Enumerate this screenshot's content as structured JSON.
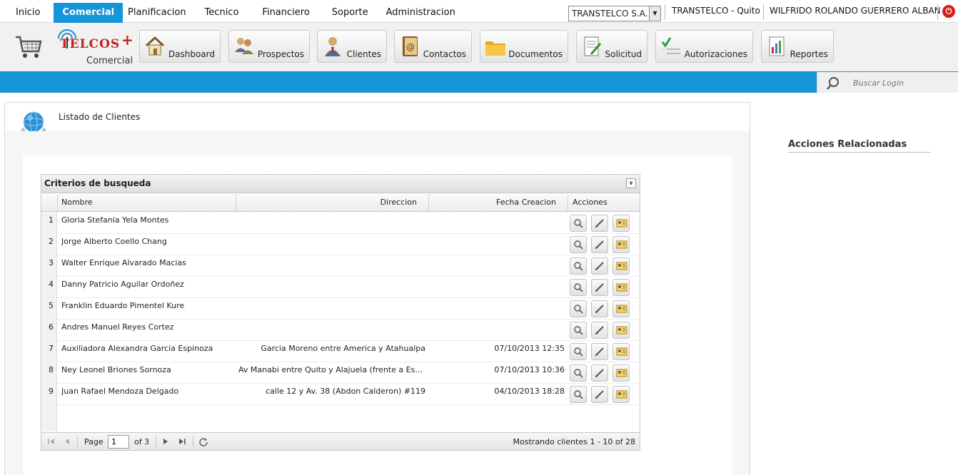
{
  "menu": {
    "items": [
      "Inicio",
      "Comercial",
      "Planificacion",
      "Tecnico",
      "Financiero",
      "Soporte",
      "Administracion"
    ],
    "active": "Comercial"
  },
  "top_right": {
    "company": "TRANSTELCO S.A.",
    "office": "TRANSTELCO - Quito",
    "user": "WILFRIDO ROLANDO GUERRERO ALBAN"
  },
  "logo": {
    "brand": "TELCOS",
    "plus": "+",
    "module": "Comercial"
  },
  "toolbar": {
    "buttons": [
      {
        "label": "Dashboard",
        "icon": "house-icon"
      },
      {
        "label": "Prospectos",
        "icon": "prospects-icon"
      },
      {
        "label": "Clientes",
        "icon": "client-person-icon"
      },
      {
        "label": "Contactos",
        "icon": "address-book-icon"
      },
      {
        "label": "Documentos",
        "icon": "folder-icon"
      },
      {
        "label": "Solicitud",
        "icon": "request-form-icon"
      },
      {
        "label": "Autorizaciones",
        "icon": "checklist-icon"
      },
      {
        "label": "Reportes",
        "icon": "report-chart-icon"
      }
    ]
  },
  "search": {
    "placeholder": "Buscar Login"
  },
  "panel": {
    "title": "Listado de Clientes"
  },
  "grid": {
    "title": "Criterios de busqueda",
    "columns": [
      "Nombre",
      "Direccion",
      "Fecha Creacion",
      "Acciones"
    ],
    "rows": [
      {
        "n": "1",
        "nombre": "Gloria Stefania Yela Montes",
        "direccion": "",
        "fecha": ""
      },
      {
        "n": "2",
        "nombre": "Jorge Alberto Coello Chang",
        "direccion": "",
        "fecha": ""
      },
      {
        "n": "3",
        "nombre": "Walter Enrique Alvarado Macias",
        "direccion": "",
        "fecha": ""
      },
      {
        "n": "4",
        "nombre": "Danny Patricio Aguilar Ordoñez",
        "direccion": "",
        "fecha": ""
      },
      {
        "n": "5",
        "nombre": "Franklin Eduardo Pimentel Kure",
        "direccion": "",
        "fecha": ""
      },
      {
        "n": "6",
        "nombre": "Andres Manuel Reyes Cortez",
        "direccion": "",
        "fecha": ""
      },
      {
        "n": "7",
        "nombre": "Auxiliadora Alexandra Garcia Espinoza",
        "direccion": "Garcia Moreno entre America y Atahualpa",
        "fecha": "07/10/2013 12:35"
      },
      {
        "n": "8",
        "nombre": "Ney Leonel Briones Sornoza",
        "direccion": "Av Manabi entre Quito y Alajuela (frente a Esc Real...",
        "fecha": "07/10/2013 10:36"
      },
      {
        "n": "9",
        "nombre": "Juan Rafael Mendoza Delgado",
        "direccion": "calle 12 y Av. 38 (Abdon Calderon) #119",
        "fecha": "04/10/2013 18:28"
      }
    ],
    "row_actions": [
      "view-icon",
      "edit-pencil-icon",
      "client-card-icon"
    ]
  },
  "pager": {
    "page_label": "Page",
    "page_value": "1",
    "of_label": "of 3",
    "summary": "Mostrando clientes 1 - 10 of 28"
  },
  "sidebar": {
    "related_title": "Acciones Relacionadas"
  },
  "colors": {
    "accent": "#1495d8",
    "brand_red": "#c0241c",
    "power": "#d91e18"
  }
}
